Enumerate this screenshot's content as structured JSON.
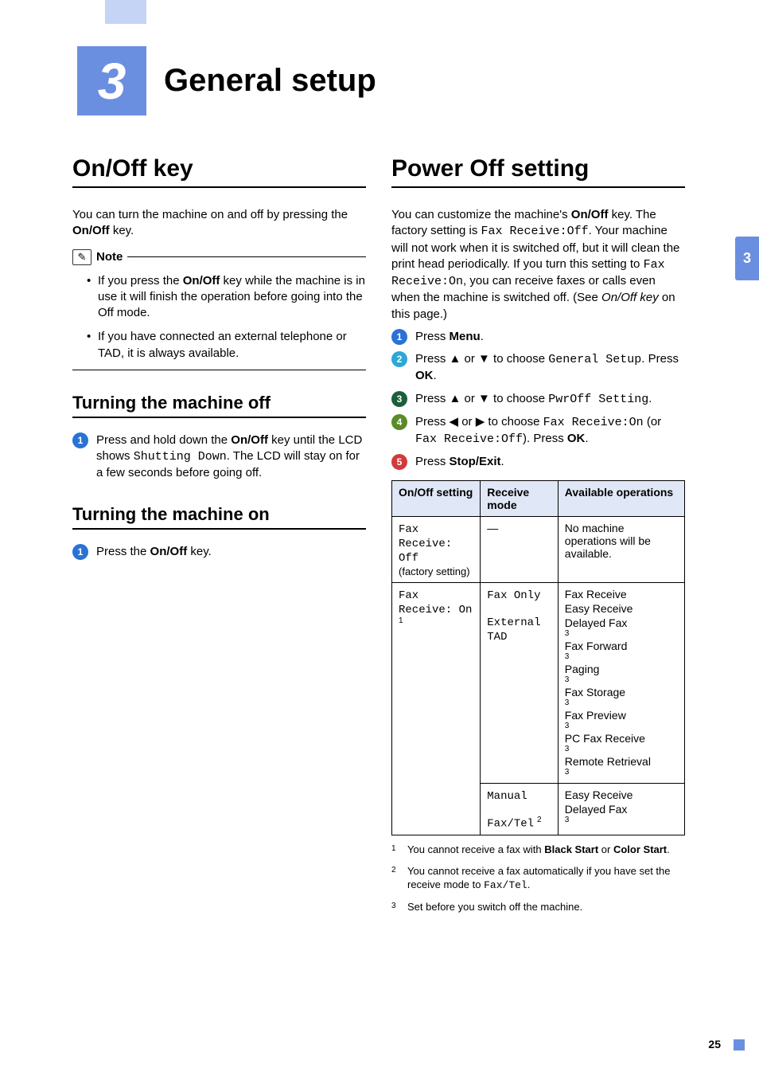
{
  "chapter": {
    "number": "3",
    "title": "General setup"
  },
  "side_tab": "3",
  "left": {
    "h1": "On/Off key",
    "intro_p1": "You can turn the machine on and off by pressing the ",
    "intro_bold": "On/Off",
    "intro_p2": " key.",
    "note_label": "Note",
    "note_items": [
      {
        "pre": "If you press the ",
        "bold": "On/Off",
        "post": " key while the machine is in use it will finish the operation before going into the Off mode."
      },
      {
        "pre": "If you have connected an external telephone or TAD, it is always available."
      }
    ],
    "h2_off": "Turning the machine off",
    "off_step": {
      "pre": "Press and hold down the ",
      "bold": "On/Off",
      "mid": " key until the LCD shows ",
      "mono": "Shutting Down",
      "post": ". The LCD will stay on for a few seconds before going off."
    },
    "h2_on": "Turning the machine on",
    "on_step": {
      "pre": "Press the ",
      "bold": "On/Off",
      "post": " key."
    }
  },
  "right": {
    "h1": "Power Off setting",
    "intro": {
      "p1": "You can customize the machine's ",
      "b1": "On/Off",
      "p2": " key. The factory setting is ",
      "m1": "Fax Receive:Off",
      "p3": ". Your machine will not work when it is switched off, but it will clean the print head periodically. If you turn this setting to ",
      "m2": "Fax Receive:On",
      "p4": ", you can receive faxes or calls even when the machine is switched off. (See ",
      "i1": "On/Off key",
      "p5": " on this page.)"
    },
    "steps": [
      {
        "num": "1",
        "cls": "sn1",
        "parts": [
          {
            "t": "Press "
          },
          {
            "b": "Menu"
          },
          {
            "t": "."
          }
        ]
      },
      {
        "num": "2",
        "cls": "sn2",
        "parts": [
          {
            "t": "Press ▲ or ▼ to choose "
          },
          {
            "m": "General Setup"
          },
          {
            "t": ". Press "
          },
          {
            "b": "OK"
          },
          {
            "t": "."
          }
        ]
      },
      {
        "num": "3",
        "cls": "sn3",
        "parts": [
          {
            "t": "Press ▲ or ▼ to choose "
          },
          {
            "m": "PwrOff Setting"
          },
          {
            "t": "."
          }
        ]
      },
      {
        "num": "4",
        "cls": "sn4",
        "parts": [
          {
            "t": "Press ◀ or ▶ to choose "
          },
          {
            "m": "Fax Receive:On"
          },
          {
            "t": " (or "
          },
          {
            "m": "Fax Receive:Off"
          },
          {
            "t": "). Press "
          },
          {
            "b": "OK"
          },
          {
            "t": "."
          }
        ]
      },
      {
        "num": "5",
        "cls": "sn5",
        "parts": [
          {
            "t": "Press "
          },
          {
            "b": "Stop/Exit"
          },
          {
            "t": "."
          }
        ]
      }
    ],
    "table": {
      "headers": [
        "On/Off setting",
        "Receive mode",
        "Available operations"
      ],
      "rows": [
        {
          "setting": {
            "mono": "Fax Receive: Off",
            "note": "(factory setting)"
          },
          "mode": "—",
          "ops": "No machine operations will be available.",
          "rowspan_setting": 1
        }
      ],
      "row2_setting": {
        "mono": "Fax Receive: On",
        "sup": "1"
      },
      "row2_mode1": "Fax Only",
      "row2_mode2": "External TAD",
      "row2_ops": [
        {
          "t": "Fax Receive"
        },
        {
          "t": "Easy Receive"
        },
        {
          "t": "Delayed Fax",
          "s": "3"
        },
        {
          "t": "Fax Forward",
          "s": "3"
        },
        {
          "t": "Paging",
          "s": "3"
        },
        {
          "t": "Fax Storage",
          "s": "3"
        },
        {
          "t": "Fax Preview",
          "s": "3"
        },
        {
          "t": "PC Fax Receive",
          "s": "3"
        },
        {
          "t": "Remote Retrieval",
          "s": "3"
        }
      ],
      "row3_mode1": "Manual",
      "row3_mode2": {
        "t": "Fax/Tel",
        "s": "2"
      },
      "row3_ops": [
        {
          "t": "Easy Receive"
        },
        {
          "t": "Delayed Fax",
          "s": "3"
        }
      ]
    },
    "footnotes": [
      {
        "n": "1",
        "pre": "You cannot receive a fax with ",
        "b1": "Black Start",
        "mid": " or ",
        "b2": "Color Start",
        "post": "."
      },
      {
        "n": "2",
        "pre": "You cannot receive a fax automatically if you have set the receive mode to ",
        "m": "Fax/Tel",
        "post": "."
      },
      {
        "n": "3",
        "pre": "Set before you switch off the machine."
      }
    ]
  },
  "page_number": "25"
}
